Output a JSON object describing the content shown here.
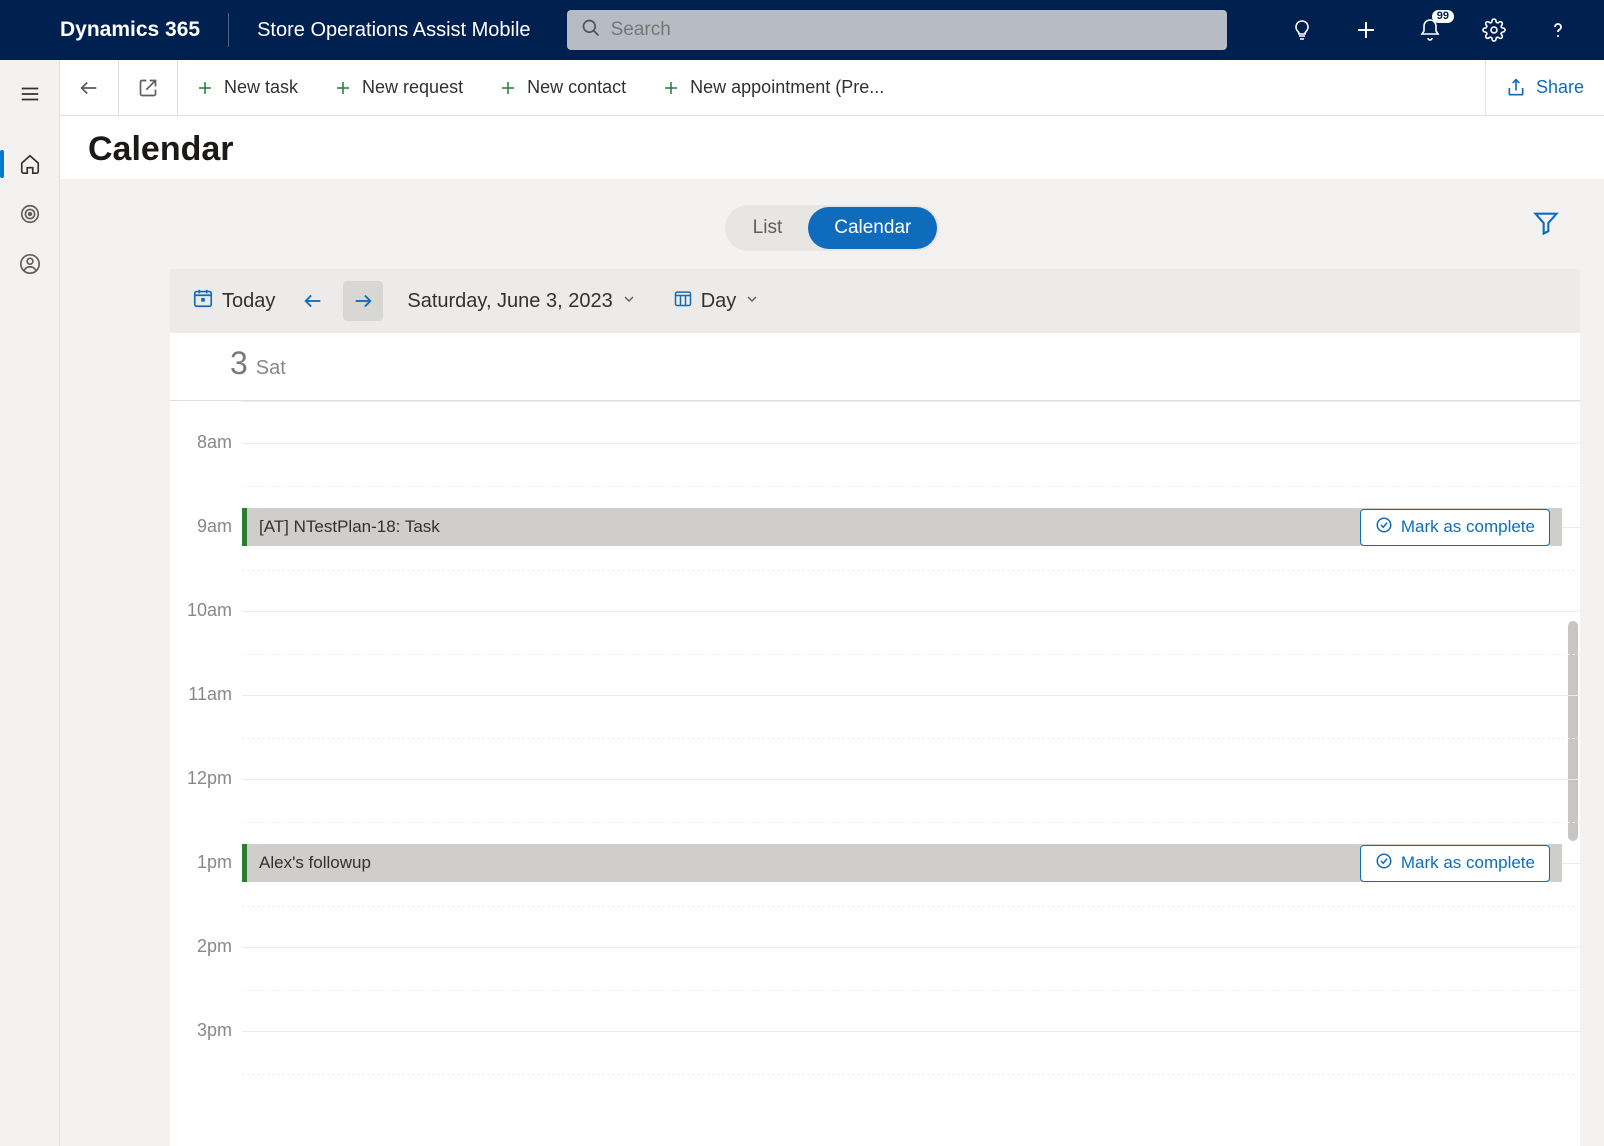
{
  "header": {
    "brand": "Dynamics 365",
    "app_name": "Store Operations Assist Mobile",
    "search_placeholder": "Search",
    "notification_count": "99"
  },
  "command_bar": {
    "new_task": "New task",
    "new_request": "New request",
    "new_contact": "New contact",
    "new_appointment": "New appointment (Pre...",
    "share": "Share"
  },
  "page": {
    "title": "Calendar"
  },
  "view_toggle": {
    "list": "List",
    "calendar": "Calendar",
    "active": "calendar"
  },
  "calendar_toolbar": {
    "today": "Today",
    "date_label": "Saturday, June 3, 2023",
    "view_mode": "Day"
  },
  "day_header": {
    "day_num": "3",
    "day_of_week": "Sat"
  },
  "time_slots": [
    "8am",
    "9am",
    "10am",
    "11am",
    "12pm",
    "1pm",
    "2pm",
    "3pm"
  ],
  "mark_complete_label": "Mark as complete",
  "events": [
    {
      "title": "[AT] NTestPlan-18: Task",
      "slot_index": 1
    },
    {
      "title": "Alex's followup",
      "slot_index": 5
    }
  ],
  "colors": {
    "brand_bg": "#002050",
    "accent": "#0f6cbd",
    "event_accent": "#2e7d32"
  }
}
